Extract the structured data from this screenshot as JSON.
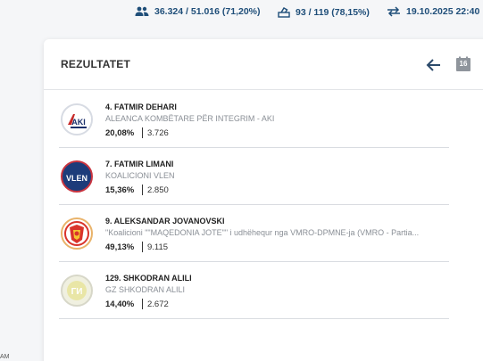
{
  "stats": {
    "voters": "36.324 / 51.016 (71,20%)",
    "stations": "93 / 119 (78,15%)",
    "updated": "19.10.2025 22:40"
  },
  "card": {
    "title": "REZULTATET",
    "calendar_day": "16"
  },
  "results": [
    {
      "candidate": "4. FATMIR DEHARI",
      "party": "ALEANCA KOMBËTARE PËR INTEGRIM - AKI",
      "percent": "20,08%",
      "votes": "3.726",
      "color": "#3b4a8c",
      "logo": "aki-logo",
      "logo_text": "AKI"
    },
    {
      "candidate": "7. FATMIR LIMANI",
      "party": "KOALICIONI VLEN",
      "percent": "15,36%",
      "votes": "2.850",
      "color": "#8b1a2b",
      "logo": "vlen-logo",
      "logo_text": "VLEN"
    },
    {
      "candidate": "9. ALEKSANDAR JOVANOVSKI",
      "party": "\"Koalicioni \"\"MAQEDONIA JOTE\"\" i udhëhequr nga VMRO-DPMNE-ja (VMRO - Partia...",
      "percent": "49,13%",
      "votes": "9.115",
      "color": "#f0a51c",
      "logo": "vmro-logo",
      "logo_text": ""
    },
    {
      "candidate": "129. SHKODRAN ALILI",
      "party": "GZ SHKODRAN ALILI",
      "percent": "14,40%",
      "votes": "2.672",
      "color": "#e4ea8c",
      "logo": "gz-logo",
      "logo_text": "ГИ"
    }
  ],
  "corner_text": "AM"
}
